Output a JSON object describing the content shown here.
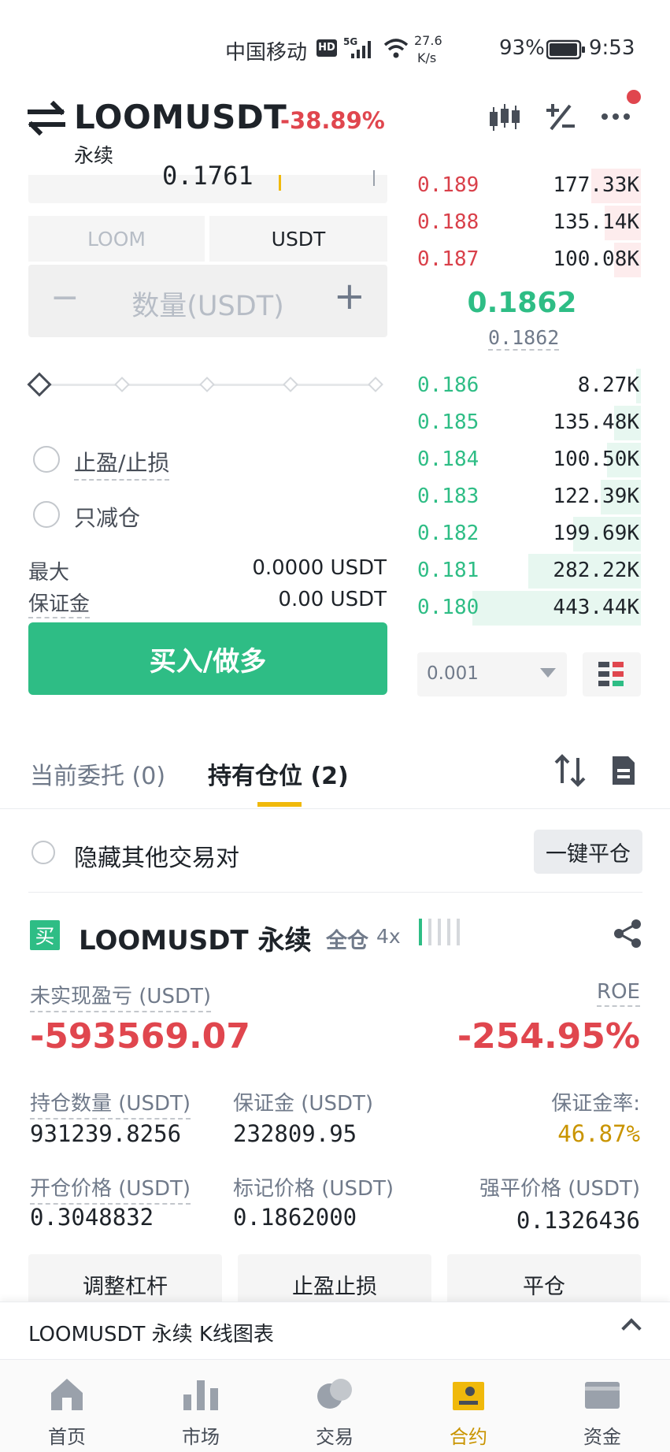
{
  "status_bar": {
    "carrier": "中国移动",
    "hd": "HD",
    "network": "5G",
    "speed_value": "27.6",
    "speed_unit": "K/s",
    "battery": "93%",
    "time": "9:53"
  },
  "header": {
    "pair": "LOOMUSDT",
    "change": "-38.89%",
    "contract_type": "永续",
    "icons": [
      "swap-icon",
      "candlestick-icon",
      "percent-icon",
      "more-icon"
    ]
  },
  "order_form": {
    "price_partial": "0.1761",
    "unit_tabs": [
      "LOOM",
      "USDT"
    ],
    "quantity_placeholder": "数量(USDT)",
    "minus": "−",
    "plus": "+",
    "tp_sl_label": "止盈/止损",
    "reduce_only_label": "只减仓",
    "max_label": "最大",
    "max_value": "0.0000 USDT",
    "margin_label": "保证金",
    "margin_value": "0.00 USDT",
    "buy_button": "买入/做多"
  },
  "order_book": {
    "asks": [
      {
        "price": "0.189",
        "qty": "177.33K",
        "depth": 0.22
      },
      {
        "price": "0.188",
        "qty": "135.14K",
        "depth": 0.16
      },
      {
        "price": "0.187",
        "qty": "100.08K",
        "depth": 0.12
      }
    ],
    "last_price": "0.1862",
    "mark_price": "0.1862",
    "bids": [
      {
        "price": "0.186",
        "qty": "8.27K",
        "depth": 0.02
      },
      {
        "price": "0.185",
        "qty": "135.48K",
        "depth": 0.12
      },
      {
        "price": "0.184",
        "qty": "100.50K",
        "depth": 0.15
      },
      {
        "price": "0.183",
        "qty": "122.39K",
        "depth": 0.18
      },
      {
        "price": "0.182",
        "qty": "199.69K",
        "depth": 0.3
      },
      {
        "price": "0.181",
        "qty": "282.22K",
        "depth": 0.5
      },
      {
        "price": "0.180",
        "qty": "443.44K",
        "depth": 0.75
      }
    ],
    "precision": "0.001"
  },
  "tabs": {
    "open_orders": "当前委托 (0)",
    "positions": "持有仓位 (2)"
  },
  "filters": {
    "hide_others": "隐藏其他交易对",
    "close_all": "一键平仓"
  },
  "position": {
    "side_badge": "买",
    "title": "LOOMUSDT 永续",
    "margin_mode": "全仓",
    "leverage": "4x",
    "unrealized_pnl_label": "未实现盈亏 (USDT)",
    "unrealized_pnl": "-593569.07",
    "roe_label": "ROE",
    "roe": "-254.95%",
    "size_label": "持仓数量 (USDT)",
    "size": "931239.8256",
    "margin_label": "保证金 (USDT)",
    "margin": "232809.95",
    "margin_ratio_label": "保证金率:",
    "margin_ratio": "46.87%",
    "entry_label": "开仓价格 (USDT)",
    "entry": "0.3048832",
    "mark_label": "标记价格 (USDT)",
    "mark": "0.1862000",
    "liq_label": "强平价格 (USDT)",
    "liq": "0.1326436",
    "buttons": [
      "调整杠杆",
      "止盈止损",
      "平仓"
    ]
  },
  "chart_bar": {
    "label": "LOOMUSDT 永续  K线图表"
  },
  "bottom_nav": [
    {
      "label": "首页",
      "icon": "home-icon"
    },
    {
      "label": "市场",
      "icon": "market-icon"
    },
    {
      "label": "交易",
      "icon": "trade-icon"
    },
    {
      "label": "合约",
      "icon": "futures-icon",
      "active": true
    },
    {
      "label": "资金",
      "icon": "wallet-icon"
    }
  ],
  "colors": {
    "green": "#2ebd85",
    "red": "#e0464e",
    "accent": "#f0b90b"
  }
}
